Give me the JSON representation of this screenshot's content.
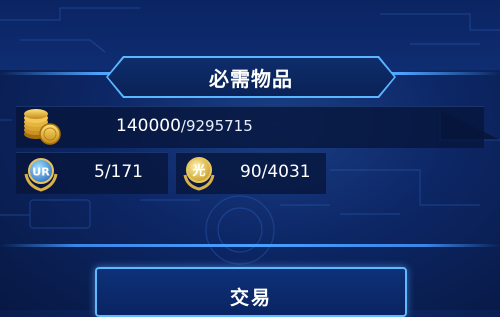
{
  "header": {
    "title": "必需物品"
  },
  "requirements": {
    "gold": {
      "icon": "gold-coins-icon",
      "current": "140000",
      "total": "/9295715"
    },
    "ur_material": {
      "icon": "ur-rarity-badge-icon",
      "value": "5/171"
    },
    "light_material": {
      "icon": "light-attribute-icon",
      "value": "90/4031"
    }
  },
  "actions": {
    "trade_label": "交易"
  },
  "colors": {
    "accent": "#59b6ff",
    "background": "#0d2766",
    "panel": "#06143a"
  }
}
